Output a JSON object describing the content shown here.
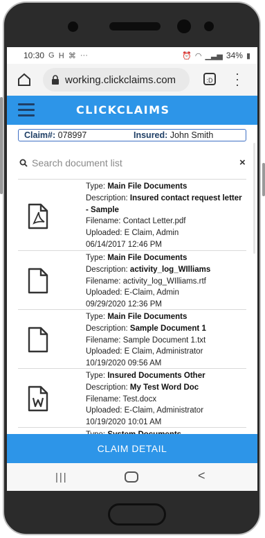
{
  "status": {
    "time": "10:30",
    "left_icons": [
      "G",
      "ᕼ",
      "⌘",
      "···"
    ],
    "battery": "34%"
  },
  "browser": {
    "url": "working.clickclaims.com",
    "tab_count": ":D"
  },
  "app": {
    "brand": "CLICKCLAIMS"
  },
  "claim": {
    "number_label": "Claim#:",
    "number": "078997",
    "insured_label": "Insured:",
    "insured": "John Smith"
  },
  "search": {
    "placeholder": "Search document list",
    "clear": "×"
  },
  "documents": [
    {
      "icon": "pdf-icon",
      "type_label": "Type:",
      "type": "Main File Documents",
      "desc_label": "Description:",
      "desc": "Insured contact request letter - Sample",
      "file_label": "Filename:",
      "file": "Contact Letter.pdf",
      "up_label": "Uploaded:",
      "uploaded_by": "E Claim, Admin",
      "date": "06/14/2017 12:46 PM"
    },
    {
      "icon": "file-icon",
      "type_label": "Type:",
      "type": "Main File Documents",
      "desc_label": "Description:",
      "desc": "activity_log_WIlliams",
      "file_label": "Filename:",
      "file": "activity_log_WIlliams.rtf",
      "up_label": "Uploaded:",
      "uploaded_by": "E-Claim, Admin",
      "date": "09/29/2020 12:36 PM"
    },
    {
      "icon": "file-icon",
      "type_label": "Type:",
      "type": "Main File Documents",
      "desc_label": "Description:",
      "desc": "Sample Document 1",
      "file_label": "Filename:",
      "file": "Sample Document 1.txt",
      "up_label": "Uploaded:",
      "uploaded_by": "E Claim, Administrator",
      "date": "10/19/2020 09:56 AM"
    },
    {
      "icon": "word-icon",
      "type_label": "Type:",
      "type": "Insured Documents Other",
      "desc_label": "Description:",
      "desc": "My Test Word Doc",
      "file_label": "Filename:",
      "file": "Test.docx",
      "up_label": "Uploaded:",
      "uploaded_by": "E-Claim, Administrator",
      "date": "10/19/2020 10:01 AM"
    },
    {
      "icon": "file-icon",
      "type_label": "Type:",
      "type": "System Documents",
      "desc_label": "",
      "desc": "",
      "file_label": "",
      "file": "",
      "up_label": "",
      "uploaded_by": "",
      "date": ""
    }
  ],
  "footer": {
    "claim_detail": "CLAIM DETAIL"
  },
  "nav": {
    "recent": "|||",
    "back": "<"
  }
}
